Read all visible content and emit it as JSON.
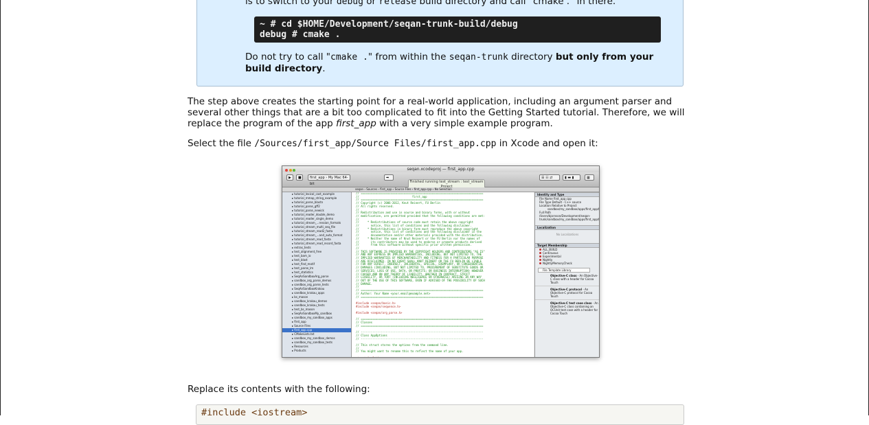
{
  "note": {
    "top_line_pre": "is to switch to your",
    "top_code_debug": "debug",
    "top_line_or": "or",
    "top_code_release": "release",
    "top_line_post": "build directory and call \"cmake .\" in there.",
    "terminal_lines": [
      "~ # cd $HOME/Development/seqan-trunk-build/debug",
      "debug # cmake ."
    ],
    "warn_pre": "Do not try to call \"",
    "warn_cmd": "cmake .",
    "warn_mid": "\" from within the",
    "warn_dir": "seqan-trunk",
    "warn_dir_post": "directory",
    "warn_bold": "but only from your build directory",
    "warn_end": "."
  },
  "para1": {
    "pre": "The step above creates the starting point for a real-world application, including an argument parser and several other things that are a bit too complicated to fit into the Getting Started tutorial. Therefore, we will replace the program of the app",
    "em": "first_app",
    "post": "with a very simple example program."
  },
  "para2": {
    "pre": "Select the file",
    "code": "/Sources/first_app/Source Files/first_app.cpp",
    "post": "in Xcode and open it:"
  },
  "para3": "Replace its contents with the following:",
  "code_first_line": "#include <iostream>",
  "xcode": {
    "window_title": "seqan.xcodeproj — first_app.cpp",
    "scheme": "first_app › My Mac 64-bit",
    "status": "Finished running test_stream : test_stream",
    "status2": "Project",
    "toolbar_labels": [
      "Run",
      "Stop",
      "Scheme",
      "Breakpoints",
      "Editor",
      "View",
      "Organizer"
    ],
    "jumpbar": "seqan › Sources › first_app › Source Files › first_app.cpp › No Selection",
    "nav_items": [
      "tutorial_lexical_cast_example",
      "tutorial_mmap_string_example",
      "tutorial_parse_blastn",
      "tutorial_parse_gff2",
      "tutorial_parse_newick",
      "tutorial_reader_double_demo",
      "tutorial_reader_single_demo",
      "tutorial_stream_...ression_formats",
      "tutorial_stream_multi_seq_file",
      "tutorial_stream_read2_fasta",
      "tutorial_stream_...and_auto_format",
      "tutorial_stream_read_fasta",
      "tutorial_stream_read_record_fasta",
      "extras_tests",
      "test_alignment_free",
      "test_bam_io",
      "test_blast",
      "test_find_motif",
      "test_parse_lm",
      "test_statistics",
      "SeqAnSandboxArg_parse",
      "sandbox_arg_parse_demos",
      "sandbox_arg_parse_tests",
      "SeqAnSandboxKrakau",
      "sandbox_krakau_apps",
      "bs_mason",
      "sandbox_krakau_demos",
      "sandbox_krakau_tests",
      "test_bs_mason",
      "SeqAnSandboxMy_sandbox",
      "sandbox_my_sandbox_apps",
      "first_app",
      "Source Files",
      "first_app.cpp",
      "CMakeLists.txt",
      "sandbox_my_sandbox_demos",
      "sandbox_my_sandbox_tests",
      "Resources",
      "Products"
    ],
    "code_lines": [
      [
        "c",
        "// =========================================================================="
      ],
      [
        "c",
        "//                                first_app"
      ],
      [
        "c",
        "// =========================================================================="
      ],
      [
        "c",
        "// Copyright (c) 2006-2012, Knut Reinert, FU Berlin"
      ],
      [
        "c",
        "// All rights reserved."
      ],
      [
        "c",
        "//"
      ],
      [
        "c",
        "// Redistribution and use in source and binary forms, with or without"
      ],
      [
        "c",
        "// modification, are permitted provided that the following conditions are met:"
      ],
      [
        "c",
        "//"
      ],
      [
        "c",
        "//     * Redistributions of source code must retain the above copyright"
      ],
      [
        "c",
        "//       notice, this list of conditions and the following disclaimer."
      ],
      [
        "c",
        "//     * Redistributions in binary form must reproduce the above copyright"
      ],
      [
        "c",
        "//       notice, this list of conditions and the following disclaimer in the"
      ],
      [
        "c",
        "//       documentation and/or other materials provided with the distribution."
      ],
      [
        "c",
        "//     * Neither the name of Knut Reinert or the FU Berlin nor the names of"
      ],
      [
        "c",
        "//       its contributors may be used to endorse or promote products derived"
      ],
      [
        "c",
        "//       from this software without specific prior written permission."
      ],
      [
        "c",
        "//"
      ],
      [
        "c",
        "// THIS SOFTWARE IS PROVIDED BY THE COPYRIGHT HOLDERS AND CONTRIBUTORS \"AS IS\""
      ],
      [
        "c",
        "// AND ANY EXPRESS OR IMPLIED WARRANTIES, INCLUDING, BUT NOT LIMITED TO, THE"
      ],
      [
        "c",
        "// IMPLIED WARRANTIES OF MERCHANTABILITY AND FITNESS FOR A PARTICULAR PURPOSE"
      ],
      [
        "c",
        "// ARE DISCLAIMED. IN NO EVENT SHALL KNUT REINERT OR THE FU BERLIN BE LIABLE"
      ],
      [
        "c",
        "// FOR ANY DIRECT, INDIRECT, INCIDENTAL, SPECIAL, EXEMPLARY, OR CONSEQUENTIAL"
      ],
      [
        "c",
        "// DAMAGES (INCLUDING, BUT NOT LIMITED TO, PROCUREMENT OF SUBSTITUTE GOODS OR"
      ],
      [
        "c",
        "// SERVICES; LOSS OF USE, DATA, OR PROFITS; OR BUSINESS INTERRUPTION) HOWEVER"
      ],
      [
        "c",
        "// CAUSED AND ON ANY THEORY OF LIABILITY, WHETHER IN CONTRACT, STRICT"
      ],
      [
        "c",
        "// LIABILITY, OR TORT (INCLUDING NEGLIGENCE OR OTHERWISE) ARISING IN ANY WAY"
      ],
      [
        "c",
        "// OUT OF THE USE OF THIS SOFTWARE, EVEN IF ADVISED OF THE POSSIBILITY OF SUCH"
      ],
      [
        "c",
        "// DAMAGE."
      ],
      [
        "c",
        "//"
      ],
      [
        "c",
        "// =========================================================================="
      ],
      [
        "c",
        "// Author: Your Name <your.email@example.net>"
      ],
      [
        "c",
        "// =========================================================================="
      ],
      [
        "",
        ""
      ],
      [
        "r",
        "#include <seqan/basic.h>"
      ],
      [
        "r",
        "#include <seqan/sequence.h>"
      ],
      [
        "",
        ""
      ],
      [
        "r",
        "#include <seqan/arg_parse.h>"
      ],
      [
        "",
        ""
      ],
      [
        "c",
        "// =========================================================================="
      ],
      [
        "c",
        "// Classes"
      ],
      [
        "c",
        "// =========================================================================="
      ],
      [
        "",
        ""
      ],
      [
        "c",
        "// --------------------------------------------------------------------------"
      ],
      [
        "c",
        "// Class AppOptions"
      ],
      [
        "c",
        "// --------------------------------------------------------------------------"
      ],
      [
        "",
        ""
      ],
      [
        "c",
        "// This struct stores the options from the command line."
      ],
      [
        "c",
        "//"
      ],
      [
        "c",
        "// You might want to rename this to reflect the name of your app."
      ],
      [
        "",
        ""
      ],
      [
        "r",
        "struct AppOptions"
      ]
    ],
    "inspector": {
      "identity_head": "Identity and Type",
      "file_name_label": "File Name",
      "file_name": "first_app.cpp",
      "file_type_label": "File Type",
      "file_type": "Default - C++ source",
      "location_label": "Location",
      "location": "Relative to Project",
      "path": "sandbox/my_sandbox/apps/first_app/first_app.cpp",
      "full_path_label": "Full Path",
      "full_path": "/Users/bjornson/Development/seqan-trunk/sandbox/my_sandbox/apps/first_app/first_app.cpp",
      "localization_head": "Localization",
      "no_localizations": "No Localizations",
      "target_head": "Target Membership",
      "targets": [
        "ALL_BUILD",
        "Continuous",
        "Experimental",
        "Nightly",
        "NightlyMemoryCheck"
      ],
      "library_select": "File Template Library",
      "templates": [
        [
          "Objective-C class",
          "- An Objective-C class with a header for Cocoa Touch"
        ],
        [
          "Objective-C protocol",
          "- An Objective-C protocol for Cocoa Touch"
        ],
        [
          "Objective-C test case class",
          "- An Objective-C class containing an OCUnit test case with a header for Cocoa Touch"
        ]
      ]
    }
  }
}
